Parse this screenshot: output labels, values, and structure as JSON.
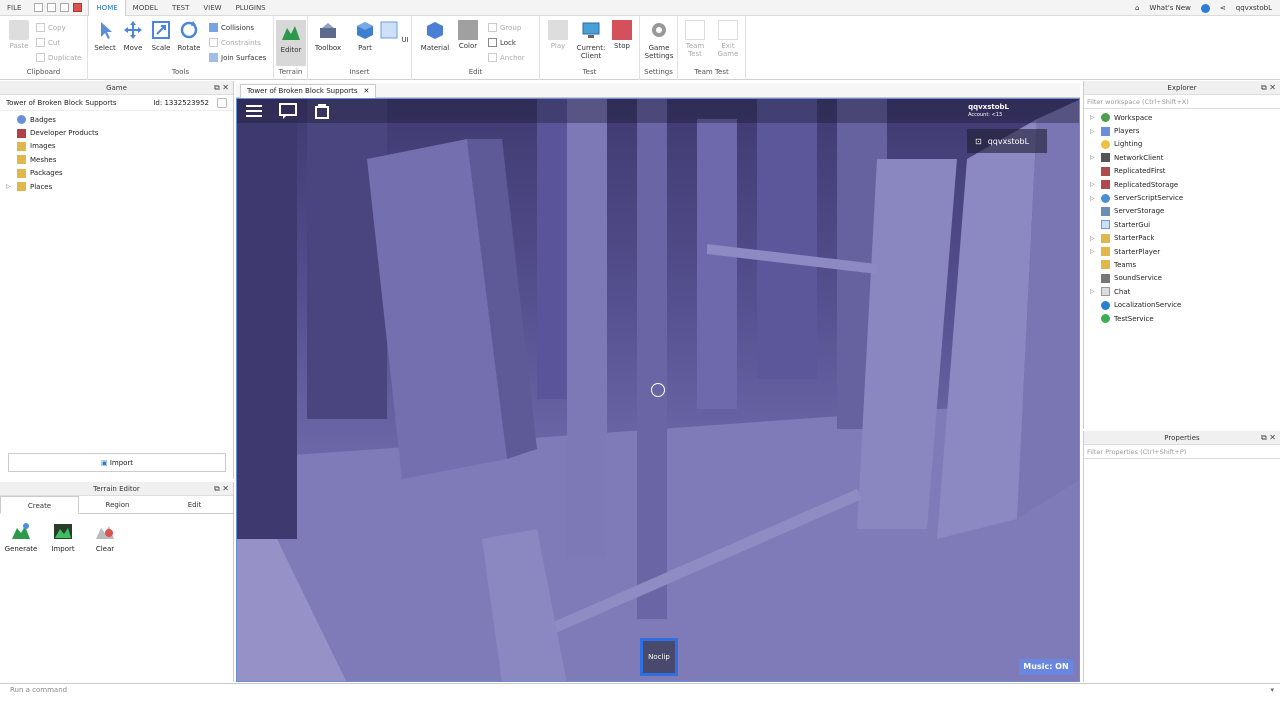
{
  "menubar": {
    "file": "FILE",
    "tabs": [
      "HOME",
      "MODEL",
      "TEST",
      "VIEW",
      "PLUGINS"
    ],
    "whats_new": "What's New",
    "username": "qqvxstobL"
  },
  "ribbon": {
    "clipboard": {
      "label": "Clipboard",
      "paste": "Paste",
      "copy": "Copy",
      "cut": "Cut",
      "duplicate": "Duplicate"
    },
    "tools": {
      "label": "Tools",
      "select": "Select",
      "move": "Move",
      "scale": "Scale",
      "rotate": "Rotate",
      "collisions": "Collisions",
      "constraints": "Constraints",
      "join_surfaces": "Join Surfaces"
    },
    "terrain": {
      "label": "Terrain",
      "editor": "Editor"
    },
    "insert": {
      "label": "Insert",
      "toolbox": "Toolbox",
      "part": "Part",
      "ui": "UI"
    },
    "edit": {
      "label": "Edit",
      "material": "Material",
      "color": "Color",
      "group": "Group",
      "lock": "Lock",
      "anchor": "Anchor"
    },
    "test": {
      "label": "Test",
      "play": "Play",
      "current_client_1": "Current:",
      "current_client_2": "Client",
      "stop": "Stop"
    },
    "settings": {
      "label": "Settings",
      "game_settings_1": "Game",
      "game_settings_2": "Settings"
    },
    "team_test": {
      "label": "Team Test",
      "team_test_1": "Team",
      "team_test_2": "Test",
      "exit_game_1": "Exit",
      "exit_game_2": "Game"
    }
  },
  "game_panel": {
    "title": "Game",
    "game_name": "Tower of Broken Block Supports",
    "game_id": "Id: 1332523952",
    "items": [
      "Badges",
      "Developer Products",
      "Images",
      "Meshes",
      "Packages",
      "Places"
    ],
    "import": "Import"
  },
  "terrain_panel": {
    "title": "Terrain Editor",
    "tabs": [
      "Create",
      "Region",
      "Edit"
    ],
    "tools": [
      "Generate",
      "Import",
      "Clear"
    ]
  },
  "viewport": {
    "tab_title": "Tower of Broken Block Supports",
    "user": "qqvxstobL",
    "account": "Account: <13",
    "player_card": "qqvxstobL",
    "noclip": "Noclip",
    "music": "Music: ON"
  },
  "explorer": {
    "title": "Explorer",
    "filter_placeholder": "Filter workspace (Ctrl+Shift+X)",
    "items": [
      "Workspace",
      "Players",
      "Lighting",
      "NetworkClient",
      "ReplicatedFirst",
      "ReplicatedStorage",
      "ServerScriptService",
      "ServerStorage",
      "StarterGui",
      "StarterPack",
      "StarterPlayer",
      "Teams",
      "SoundService",
      "Chat",
      "LocalizationService",
      "TestService"
    ]
  },
  "properties": {
    "title": "Properties",
    "filter_placeholder": "Filter Properties (Ctrl+Shift+P)"
  },
  "command_bar": {
    "placeholder": "Run a command"
  },
  "colors": {
    "accent": "#1a73c9",
    "viewport_purple": "#5f5a9a",
    "noclip_border": "#2f6fe0",
    "music_bg": "#6a87e0"
  }
}
